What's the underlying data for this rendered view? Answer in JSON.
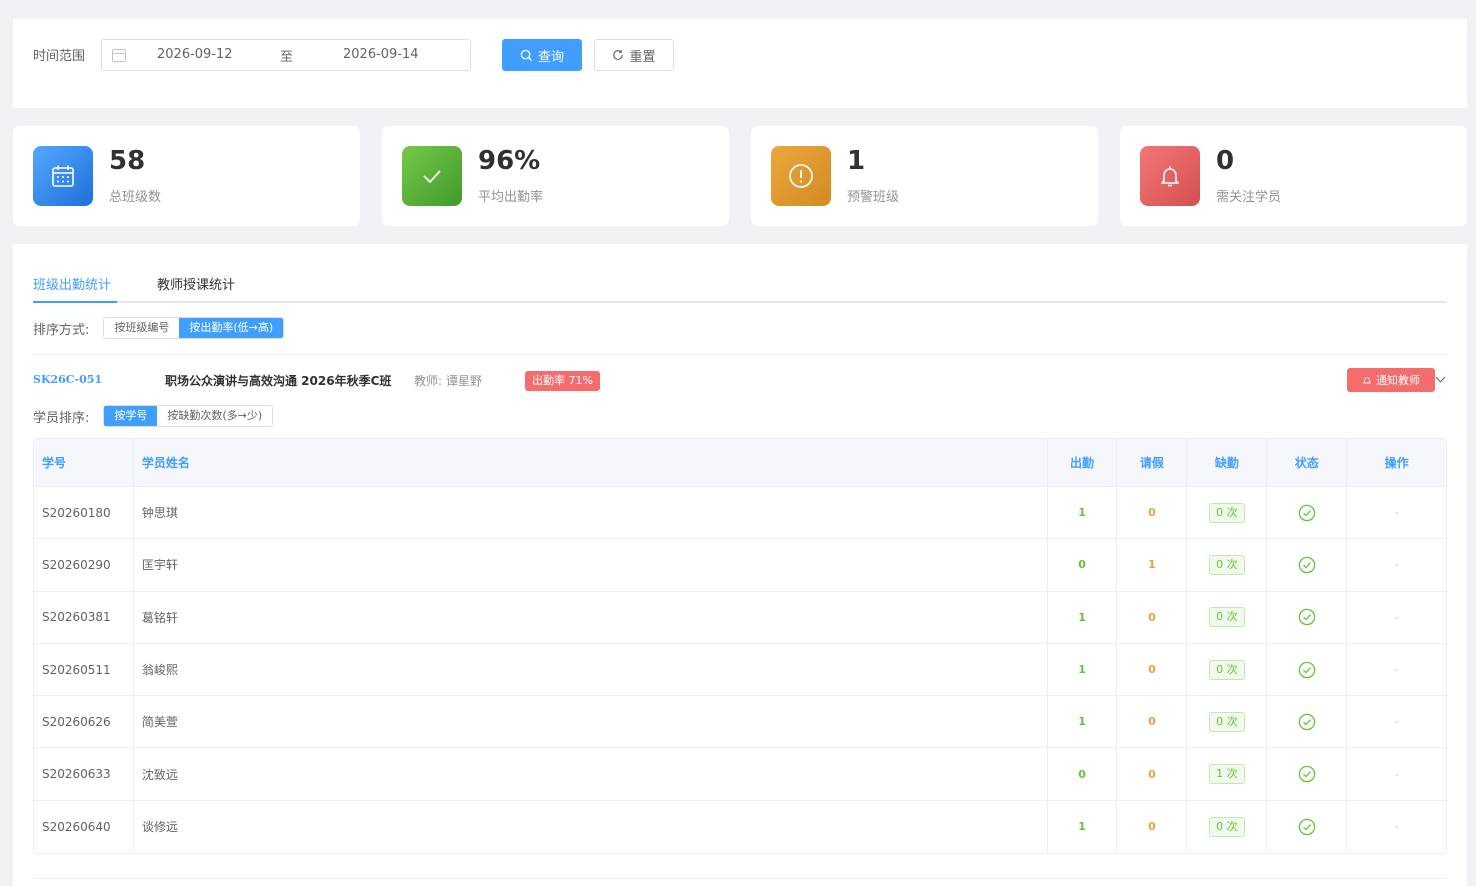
{
  "filter": {
    "label": "时间范围",
    "start_date": "2026-09-12",
    "separator": "至",
    "end_date": "2026-09-14",
    "query_label": "查询",
    "reset_label": "重置"
  },
  "stats": [
    {
      "value": "58",
      "label": "总班级数",
      "icon": "calendar-icon",
      "color": "#409eff"
    },
    {
      "value": "96%",
      "label": "平均出勤率",
      "icon": "check-icon",
      "color": "#67c23a"
    },
    {
      "value": "1",
      "label": "预警班级",
      "icon": "warning-icon",
      "color": "#e6a23c"
    },
    {
      "value": "0",
      "label": "需关注学员",
      "icon": "bell-icon",
      "color": "#f56c6c"
    }
  ],
  "tabs": [
    {
      "label": "班级出勤统计",
      "active": true
    },
    {
      "label": "教师授课统计",
      "active": false
    }
  ],
  "sort": {
    "label": "排序方式:",
    "options": [
      "按班级编号",
      "按出勤率(低→高)"
    ],
    "selected": 1
  },
  "class_info": {
    "code": "SK26C-051",
    "name": "职场公众演讲与高效沟通 2026年秋季C班",
    "teacher": "教师: 谭星野",
    "rate": "出勤率 71%",
    "notify_label": "通知教师"
  },
  "student_sort": {
    "label": "学员排序:",
    "options": [
      "按学号",
      "按缺勤次数(多→少)"
    ],
    "selected": 0
  },
  "table": {
    "headers": [
      "学号",
      "学员姓名",
      "出勤",
      "请假",
      "缺勤",
      "状态",
      "操作"
    ],
    "rows": [
      {
        "id": "S20260180",
        "name": "钟思琪",
        "attend": "1",
        "leave": "0",
        "absent": "0 次",
        "action": "-"
      },
      {
        "id": "S20260290",
        "name": "匡宇轩",
        "attend": "0",
        "leave": "1",
        "absent": "0 次",
        "action": "-"
      },
      {
        "id": "S20260381",
        "name": "葛铭轩",
        "attend": "1",
        "leave": "0",
        "absent": "0 次",
        "action": "-"
      },
      {
        "id": "S20260511",
        "name": "翁峻熙",
        "attend": "1",
        "leave": "0",
        "absent": "0 次",
        "action": "-"
      },
      {
        "id": "S20260626",
        "name": "简美萱",
        "attend": "1",
        "leave": "0",
        "absent": "0 次",
        "action": "-"
      },
      {
        "id": "S20260633",
        "name": "沈致远",
        "attend": "0",
        "leave": "0",
        "absent": "1 次",
        "action": "-"
      },
      {
        "id": "S20260640",
        "name": "谈修远",
        "attend": "1",
        "leave": "0",
        "absent": "0 次",
        "action": "-"
      }
    ]
  }
}
